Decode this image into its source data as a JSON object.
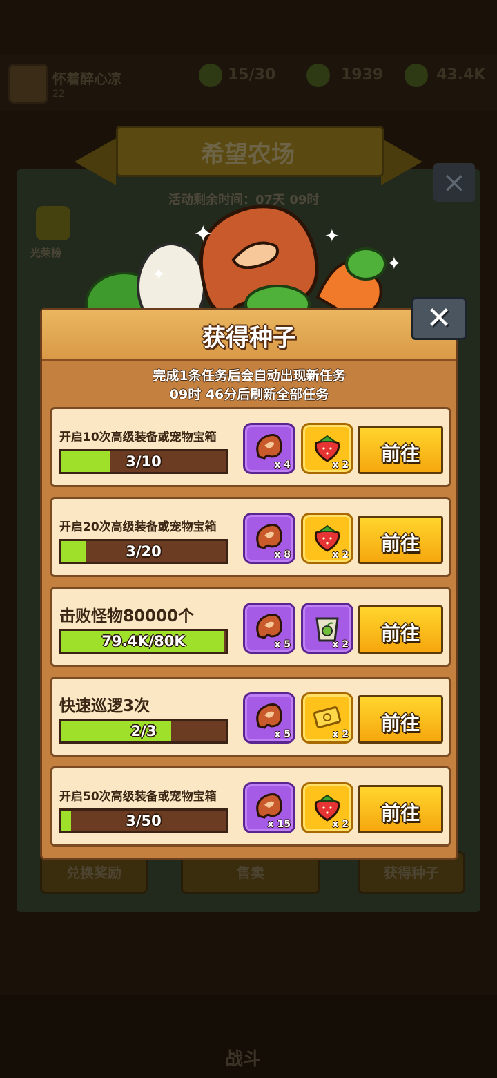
{
  "background": {
    "player_name": "怀着醉心凉",
    "player_level": "22",
    "resource_1": "15/30",
    "resource_2": "1939",
    "resource_3": "43.4K",
    "farm_title": "希望农场",
    "timer": "活动剩余时间：07天 09时",
    "rank_label": "光荣榜",
    "bottom_buttons": [
      "兑换奖励",
      "售卖",
      "获得种子"
    ],
    "nav_battle": "战斗"
  },
  "dialog": {
    "title": "获得种子",
    "close_label": "✕",
    "subtitle_line1": "完成1条任务后会自动出现新任务",
    "subtitle_line2": "09时 46分后刷新全部任务",
    "tasks": [
      {
        "title": "开启10次高级装备或宠物宝箱",
        "progress": "3/10",
        "fill_ratio": 0.3,
        "reward1": {
          "icon": "bean-icon",
          "qty": "x 4"
        },
        "reward2": {
          "icon": "strawberry-icon",
          "qty": "x 2"
        },
        "button": "前往"
      },
      {
        "title": "开启20次高级装备或宠物宝箱",
        "progress": "3/20",
        "fill_ratio": 0.15,
        "reward1": {
          "icon": "bean-icon",
          "qty": "x 8"
        },
        "reward2": {
          "icon": "strawberry-icon",
          "qty": "x 2"
        },
        "button": "前往"
      },
      {
        "title": "击败怪物80000个",
        "progress": "79.4K/80K",
        "fill_ratio": 0.99,
        "reward1": {
          "icon": "bean-icon",
          "qty": "x 5"
        },
        "reward2": {
          "icon": "seed-bag-icon",
          "qty": "x 2"
        },
        "button": "前往"
      },
      {
        "title": "快速巡逻3次",
        "progress": "2/3",
        "fill_ratio": 0.667,
        "reward1": {
          "icon": "bean-icon",
          "qty": "x 5"
        },
        "reward2": {
          "icon": "ticket-icon",
          "qty": "x 2"
        },
        "button": "前往"
      },
      {
        "title": "开启50次高级装备或宠物宝箱",
        "progress": "3/50",
        "fill_ratio": 0.06,
        "reward1": {
          "icon": "bean-icon",
          "qty": "x 15"
        },
        "reward2": {
          "icon": "strawberry-icon",
          "qty": "x 2"
        },
        "button": "前往"
      }
    ]
  },
  "colors": {
    "progress_fill": "#9fe02a",
    "button_gold": "#f6a70e",
    "reward_purple": "#a55be6",
    "reward_gold": "#ffc21a"
  }
}
